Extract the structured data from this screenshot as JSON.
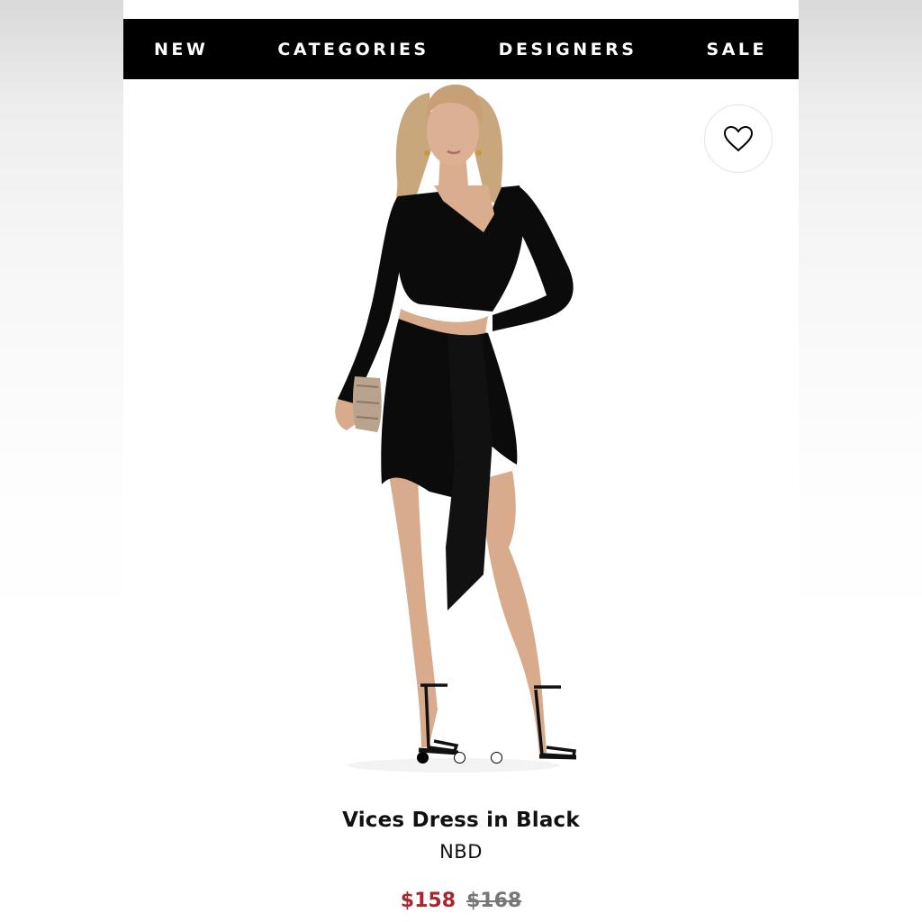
{
  "nav": {
    "items": [
      "NEW",
      "CATEGORIES",
      "DESIGNERS",
      "SALE"
    ]
  },
  "favorite": {
    "icon": "heart-icon"
  },
  "carousel": {
    "count": 3,
    "active_index": 0
  },
  "product": {
    "title": "Vices Dress in Black",
    "brand": "NBD",
    "sale_price": "$158",
    "original_price": "$168"
  },
  "colors": {
    "nav_background": "#000000",
    "sale_price": "#a8262c",
    "original_price": "#777777"
  }
}
